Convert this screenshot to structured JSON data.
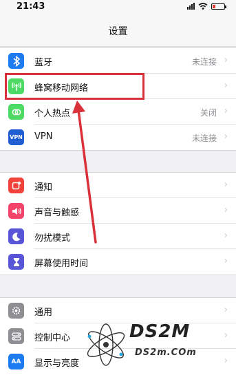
{
  "status": {
    "time": "21:43"
  },
  "nav": {
    "title": "设置"
  },
  "group1": [
    {
      "icon": "bluetooth-icon",
      "color": "#1d7bf0",
      "glyph": "ᛒ",
      "label": "蓝牙",
      "value": "未连接"
    },
    {
      "icon": "cellular-antenna-icon",
      "color": "#4cd964",
      "glyph": "((•))",
      "label": "蜂窝移动网络",
      "value": ""
    },
    {
      "icon": "hotspot-icon",
      "color": "#4cd964",
      "glyph": "∞",
      "label": "个人热点",
      "value": "关闭"
    },
    {
      "icon": "vpn-icon",
      "color": "#1f5fd1",
      "glyph": "VPN",
      "label": "VPN",
      "value": "未连接"
    }
  ],
  "group2": [
    {
      "icon": "notifications-icon",
      "color": "#f2433b",
      "glyph": "▣",
      "label": "通知"
    },
    {
      "icon": "sounds-icon",
      "color": "#f2436a",
      "glyph": "◀)",
      "label": "声音与触感"
    },
    {
      "icon": "do-not-disturb-moon-icon",
      "color": "#5856d6",
      "glyph": "☾",
      "label": "勿扰模式"
    },
    {
      "icon": "hourglass-icon",
      "color": "#5856d6",
      "glyph": "⧗",
      "label": "屏幕使用时间"
    }
  ],
  "group3": [
    {
      "icon": "gear-icon",
      "color": "#8e8e93",
      "glyph": "⚙",
      "label": "通用"
    },
    {
      "icon": "control-center-icon",
      "color": "#8e8e93",
      "glyph": "⊜",
      "label": "控制中心"
    },
    {
      "icon": "display-brightness-icon",
      "color": "#1d7bf0",
      "glyph": "AA",
      "label": "显示与亮度"
    }
  ],
  "watermark": {
    "title": "DS2M",
    "url": "DS2m.COm"
  }
}
